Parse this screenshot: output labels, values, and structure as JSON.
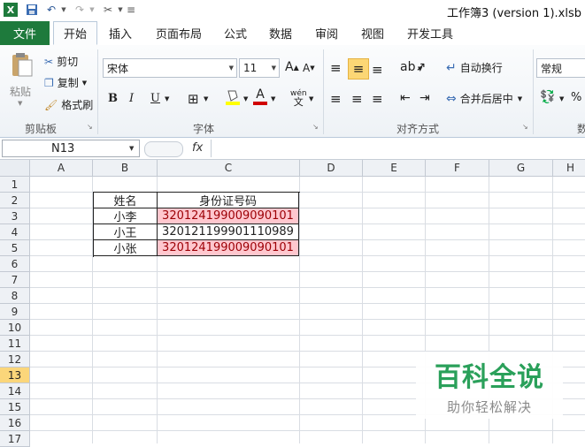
{
  "window": {
    "title": "工作簿3 (version 1).xlsb"
  },
  "ribbon_tabs": {
    "file": "文件",
    "home": "开始",
    "insert": "插入",
    "page_layout": "页面布局",
    "formulas": "公式",
    "data": "数据",
    "review": "审阅",
    "view": "视图",
    "developer": "开发工具"
  },
  "clipboard": {
    "label": "剪贴板",
    "paste": "粘贴",
    "cut": "剪切",
    "copy": "复制",
    "format_painter": "格式刷"
  },
  "font": {
    "label": "字体",
    "name": "宋体",
    "size": "11",
    "bold": "B",
    "italic": "I",
    "underline": "U"
  },
  "alignment": {
    "label": "对齐方式",
    "wrap": "自动换行",
    "merge": "合并后居中"
  },
  "number": {
    "format": "常规",
    "label": "数",
    "percent": "%"
  },
  "formula_bar": {
    "cell_ref": "N13",
    "fx": "fx",
    "value": ""
  },
  "columns": [
    "A",
    "B",
    "C",
    "D",
    "E",
    "F",
    "G",
    "H"
  ],
  "rows": [
    "1",
    "2",
    "3",
    "4",
    "5",
    "6",
    "7",
    "8",
    "9",
    "10",
    "11",
    "12",
    "13",
    "14",
    "15",
    "16",
    "17"
  ],
  "table": {
    "headers": [
      "姓名",
      "身份证号码"
    ],
    "rows": [
      {
        "name": "小李",
        "id": "320124199009090101",
        "duplicate": true
      },
      {
        "name": "小王",
        "id": "320121199901110989",
        "duplicate": false
      },
      {
        "name": "小张",
        "id": "320124199009090101",
        "duplicate": true
      }
    ]
  },
  "watermark": {
    "title": "百科全说",
    "subtitle": "助你轻松解决"
  },
  "colors": {
    "file_tab": "#1e7a3c",
    "highlight_fill": "#ffc7ce",
    "highlight_text": "#9c0006",
    "selected_row": "#fbd67a",
    "watermark_green": "#2aa05a"
  }
}
